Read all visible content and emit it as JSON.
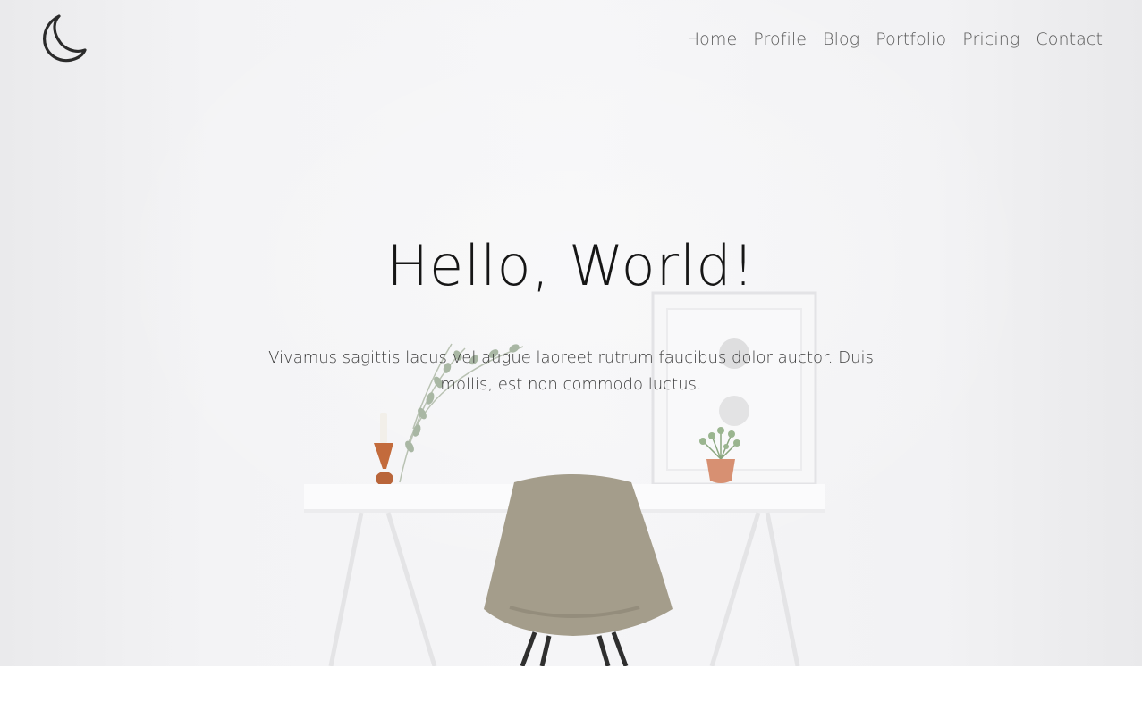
{
  "brand": {
    "logo_icon": "moon-icon"
  },
  "nav": {
    "items": [
      {
        "label": "Home"
      },
      {
        "label": "Profile"
      },
      {
        "label": "Blog"
      },
      {
        "label": "Portfolio"
      },
      {
        "label": "Pricing"
      },
      {
        "label": "Contact"
      }
    ]
  },
  "hero": {
    "title": "Hello, World!",
    "subtitle": "Vivamus sagittis lacus vel augue laoreet rutrum faucibus dolor auctor. Duis mollis, est non commodo luctus."
  },
  "colors": {
    "nav_text": "#5a5a5a",
    "title_text": "#161616",
    "body_text": "#3a3a3a",
    "hero_bg": "#f4f4f6",
    "chair": "#a49d8b",
    "vase": "#c36b3c",
    "planter": "#d79072"
  }
}
